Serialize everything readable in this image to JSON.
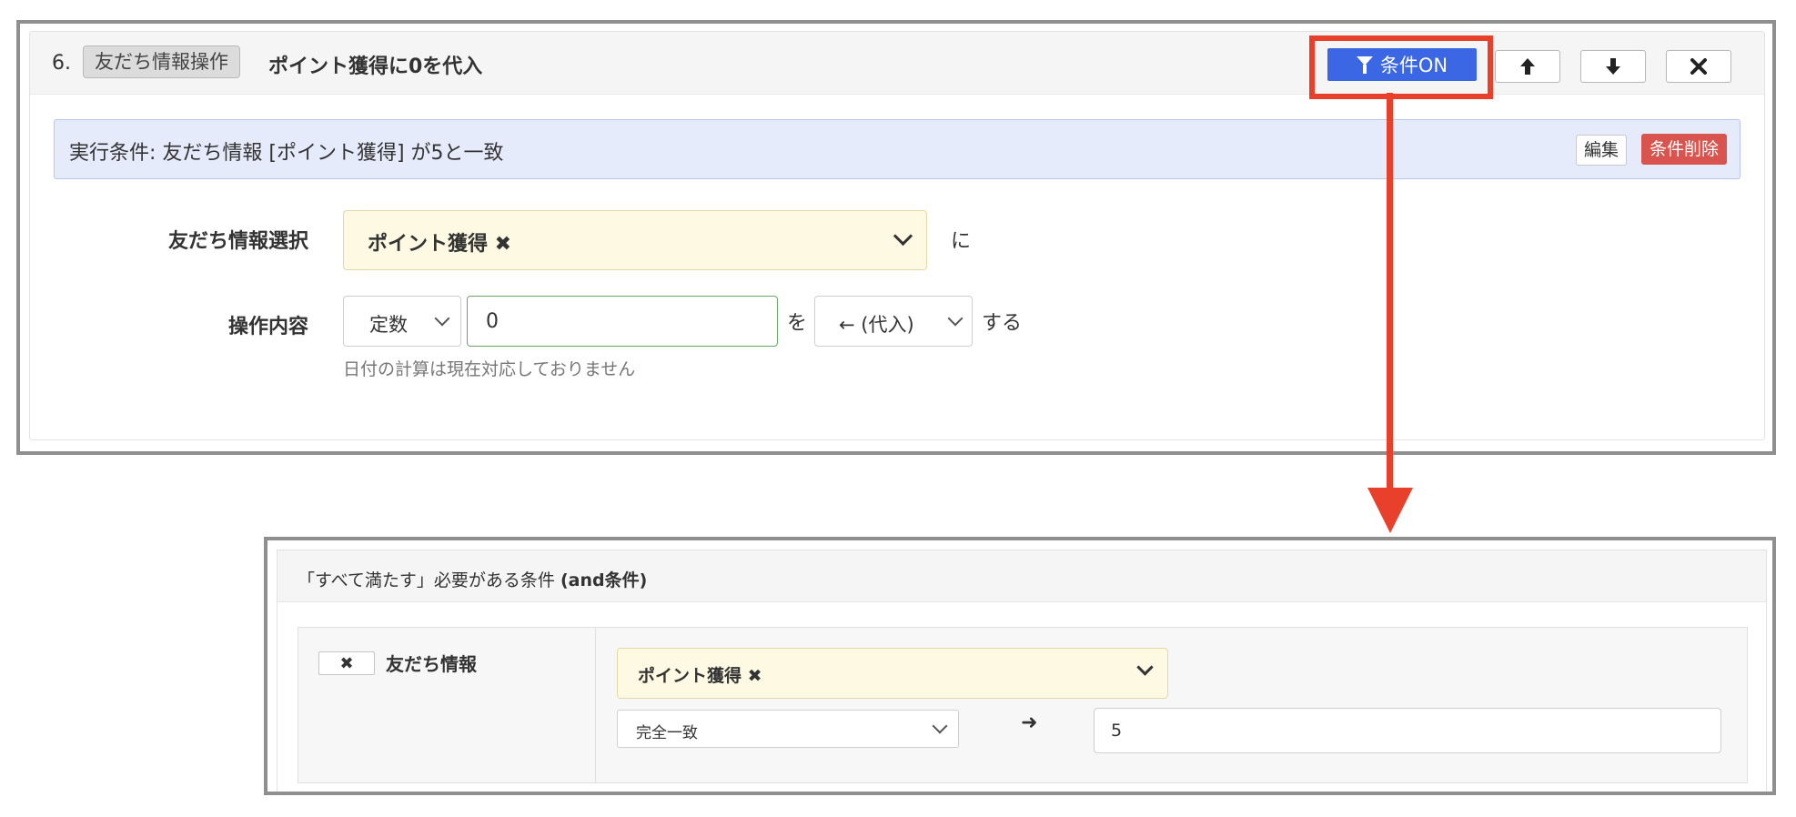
{
  "step": {
    "number": "6.",
    "tag": "友だち情報操作",
    "title": "ポイント獲得に0を代入",
    "condition_button": "条件ON",
    "move_up_icon": "arrow-up-icon",
    "move_down_icon": "arrow-down-icon",
    "remove_icon": "close-icon"
  },
  "condition_bar": {
    "text": "実行条件: 友だち情報 [ポイント獲得] が5と一致",
    "edit_label": "編集",
    "delete_label": "条件削除"
  },
  "form": {
    "friend_info_label": "友だち情報選択",
    "friend_info_value": "ポイント獲得 ✖",
    "friend_info_suffix": "に",
    "operation_label": "操作内容",
    "value_type": "定数",
    "value": "0",
    "particle_wo": "を",
    "operator": "← (代入)",
    "suffix_suru": "する",
    "help_text": "日付の計算は現在対応しておりません"
  },
  "colors": {
    "accent_blue": "#3c67e4",
    "highlight_red": "#e8402a",
    "danger_red": "#d9534f",
    "condition_bg": "#e6ebfb",
    "select_yellow": "#fdf9e3"
  },
  "and_panel": {
    "title_prefix": "「すべて満たす」必要がある条件",
    "title_bold": "(and条件)",
    "remove_label": "✖",
    "condition_label": "友だち情報",
    "field_value": "ポイント獲得 ✖",
    "match_type": "完全一致",
    "arrow": "➜",
    "match_value": "5"
  }
}
